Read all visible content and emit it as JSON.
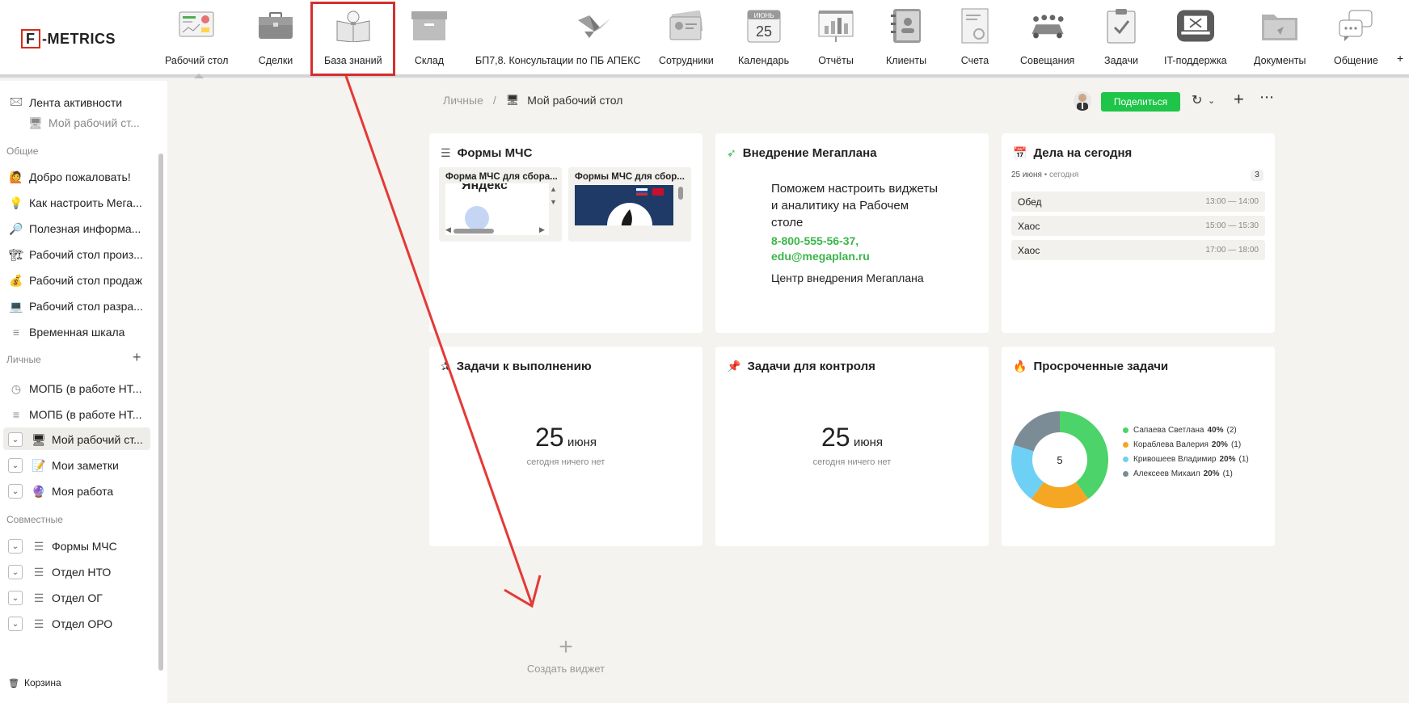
{
  "logo": {
    "box_letter": "F",
    "text": "-METRICS"
  },
  "nav": [
    {
      "label": "Рабочий стол",
      "icon": "dashboard-icon"
    },
    {
      "label": "Сделки",
      "icon": "briefcase-icon"
    },
    {
      "label": "База знаний",
      "icon": "book-lightbulb-icon"
    },
    {
      "label": "Склад",
      "icon": "box-icon"
    },
    {
      "label": "БП7,8. Консультации по ПБ АПЕКС",
      "icon": "origami-icon"
    },
    {
      "label": "Сотрудники",
      "icon": "id-cards-icon"
    },
    {
      "label": "Календарь",
      "icon": "calendar-icon",
      "month": "ИЮНЬ",
      "day": "25"
    },
    {
      "label": "Отчёты",
      "icon": "chart-board-icon"
    },
    {
      "label": "Клиенты",
      "icon": "address-book-icon"
    },
    {
      "label": "Счета",
      "icon": "invoice-icon"
    },
    {
      "label": "Совещания",
      "icon": "meeting-icon"
    },
    {
      "label": "Задачи",
      "icon": "clipboard-check-icon"
    },
    {
      "label": "IT-поддержка",
      "icon": "laptop-tools-icon"
    },
    {
      "label": "Документы",
      "icon": "folder-icon"
    },
    {
      "label": "Общение",
      "icon": "chat-bubbles-icon"
    },
    {
      "label": "+",
      "icon": "plus-icon"
    }
  ],
  "sidebar": {
    "feed": "Лента активности",
    "pinned": "Мой рабочий ст...",
    "section_common": "Общие",
    "common": [
      {
        "label": "Добро пожаловать!",
        "icon": "🙋"
      },
      {
        "label": "Как настроить Мега...",
        "icon": "💡"
      },
      {
        "label": "Полезная информа...",
        "icon": "🔎"
      },
      {
        "label": "Рабочий стол произ...",
        "icon": "🏗"
      },
      {
        "label": "Рабочий стол продаж",
        "icon": "💰"
      },
      {
        "label": "Рабочий стол разра...",
        "icon": "💻"
      },
      {
        "label": "Временная шкала",
        "icon": "≡"
      }
    ],
    "section_personal": "Личные",
    "personal": [
      {
        "label": "МОПБ (в работе НТ...",
        "icon": "◷",
        "chev": false
      },
      {
        "label": "МОПБ (в работе НТ...",
        "icon": "≡",
        "chev": false
      },
      {
        "label": "Мой рабочий ст...",
        "icon": "🖥",
        "chev": true
      },
      {
        "label": "Мои заметки",
        "icon": "📝",
        "chev": true
      },
      {
        "label": "Моя работа",
        "icon": "🔮",
        "chev": true
      }
    ],
    "section_shared": "Совместные",
    "shared": [
      {
        "label": "Формы МЧС",
        "icon": "☰"
      },
      {
        "label": "Отдел НТО",
        "icon": "☰"
      },
      {
        "label": "Отдел ОГ",
        "icon": "☰"
      },
      {
        "label": "Отдел ОРО",
        "icon": "☰"
      }
    ],
    "trash": "Корзина"
  },
  "breadcrumb": {
    "parent": "Личные",
    "sep": "/",
    "current": "Мой рабочий стол"
  },
  "toolbar": {
    "share": "Поделиться"
  },
  "widgets": {
    "forms": {
      "title": "Формы МЧС",
      "items": [
        "Форма МЧС для сбора...",
        "Формы МЧС для сбор..."
      ],
      "fragment_text": "Яндекс"
    },
    "megaplan": {
      "title": "Внедрение Мегаплана",
      "text": "Поможем настроить виджеты и аналитику на Рабочем столе",
      "phone": "8-800-555-56-37,",
      "email": "edu@megaplan.ru",
      "center": "Центр внедрения Мегаплана"
    },
    "today": {
      "title": "Дела на сегодня",
      "date": "25 июня",
      "sub": "сегодня",
      "count": "3",
      "items": [
        {
          "name": "Обед",
          "time": "13:00 — 14:00"
        },
        {
          "name": "Хаос",
          "time": "15:00 — 15:30"
        },
        {
          "name": "Хаос",
          "time": "17:00 — 18:00"
        }
      ]
    },
    "todo": {
      "title": "Задачи к выполнению",
      "day": "25",
      "month": "июня",
      "empty": "сегодня ничего нет"
    },
    "control": {
      "title": "Задачи для контроля",
      "day": "25",
      "month": "июня",
      "empty": "сегодня ничего нет"
    },
    "overdue": {
      "title": "Просроченные задачи",
      "total": "5"
    }
  },
  "chart_data": {
    "type": "pie",
    "title": "Просроченные задачи",
    "center_label": "5",
    "slices": [
      {
        "name": "Сапаева Светлана",
        "percent": 40,
        "count": 2,
        "color": "#4cd36a"
      },
      {
        "name": "Кораблева Валерия",
        "percent": 20,
        "count": 1,
        "color": "#f5a623"
      },
      {
        "name": "Кривошеев Владимир",
        "percent": 20,
        "count": 1,
        "color": "#6fd0f5"
      },
      {
        "name": "Алексеев Михаил",
        "percent": 20,
        "count": 1,
        "color": "#7b8c97"
      }
    ]
  },
  "create_widget": "Создать виджет",
  "colors": {
    "accent_green": "#1ec548",
    "annotation_red": "#d32f2f"
  }
}
